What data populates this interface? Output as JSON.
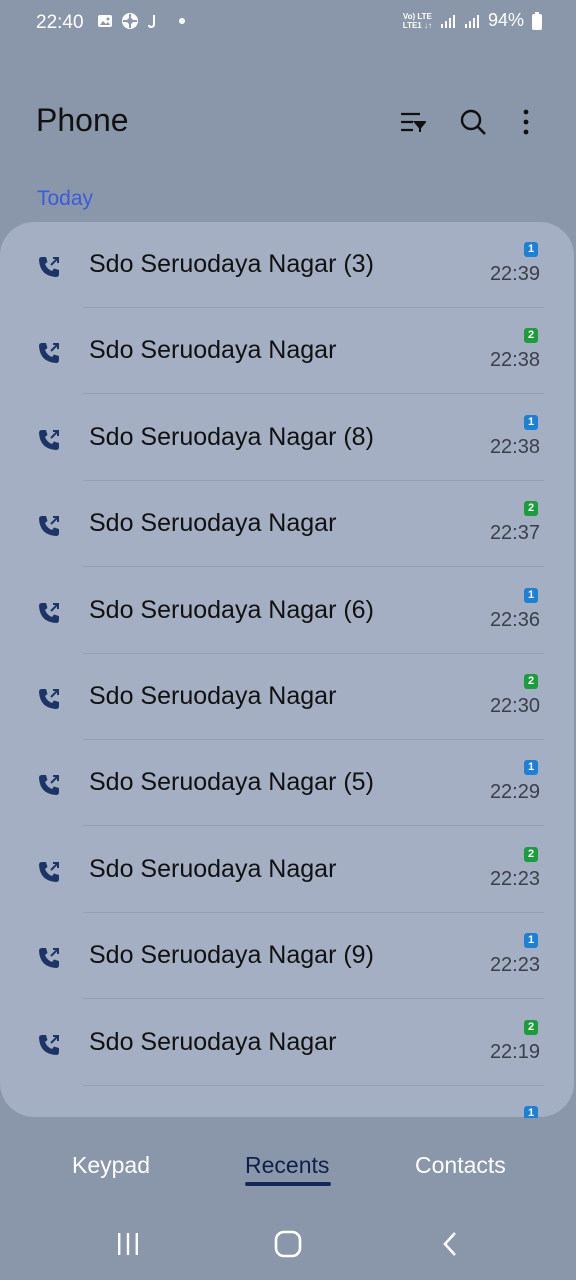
{
  "statusbar": {
    "time": "22:40",
    "network": {
      "line1": "Vo) LTE",
      "line2": "LTE1 ↓↑"
    },
    "battery": "94%"
  },
  "header": {
    "title": "Phone"
  },
  "section": {
    "label": "Today"
  },
  "calls": [
    {
      "name": "Sdo Seruodaya Nagar (3)",
      "sim": "1",
      "time": "22:39"
    },
    {
      "name": "Sdo Seruodaya Nagar",
      "sim": "2",
      "time": "22:38"
    },
    {
      "name": "Sdo Seruodaya Nagar (8)",
      "sim": "1",
      "time": "22:38"
    },
    {
      "name": "Sdo Seruodaya Nagar",
      "sim": "2",
      "time": "22:37"
    },
    {
      "name": "Sdo Seruodaya Nagar (6)",
      "sim": "1",
      "time": "22:36"
    },
    {
      "name": "Sdo Seruodaya Nagar",
      "sim": "2",
      "time": "22:30"
    },
    {
      "name": "Sdo Seruodaya Nagar (5)",
      "sim": "1",
      "time": "22:29"
    },
    {
      "name": "Sdo Seruodaya Nagar",
      "sim": "2",
      "time": "22:23"
    },
    {
      "name": "Sdo Seruodaya Nagar (9)",
      "sim": "1",
      "time": "22:23"
    },
    {
      "name": "Sdo Seruodaya Nagar",
      "sim": "2",
      "time": "22:19"
    }
  ],
  "partial_next_sim": "1",
  "tabs": [
    {
      "label": "Keypad"
    },
    {
      "label": "Recents"
    },
    {
      "label": "Contacts"
    }
  ],
  "colors": {
    "background": "#8a97aa",
    "card": "#a4afc3",
    "accent": "#3b5bd9",
    "sim1": "#1f7fd0",
    "sim2": "#1e9b3c"
  },
  "icons": {
    "call": "outgoing-call-icon",
    "filter": "filter-icon",
    "search": "search-icon",
    "more": "more-vert-icon"
  }
}
